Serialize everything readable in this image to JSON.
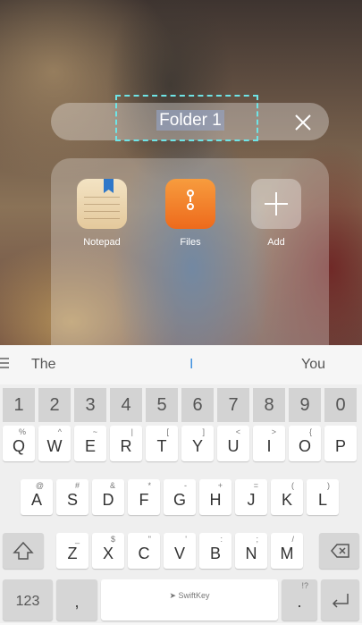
{
  "folder": {
    "name": "Folder 1",
    "close_icon": "close-icon",
    "apps": [
      {
        "label": "Notepad",
        "icon": "notepad-icon"
      },
      {
        "label": "Files",
        "icon": "files-icon"
      },
      {
        "label": "Add",
        "icon": "add-icon"
      }
    ]
  },
  "keyboard": {
    "suggestions": {
      "left": "The",
      "center": "I",
      "right": "You"
    },
    "numbers": [
      "1",
      "2",
      "3",
      "4",
      "5",
      "6",
      "7",
      "8",
      "9",
      "0"
    ],
    "row1": {
      "keys": [
        "Q",
        "W",
        "E",
        "R",
        "T",
        "Y",
        "U",
        "I",
        "O",
        "P"
      ],
      "secondary": [
        "%",
        "^",
        "~",
        "|",
        "[",
        "]",
        "<",
        ">",
        "{",
        ""
      ]
    },
    "row2": {
      "keys": [
        "A",
        "S",
        "D",
        "F",
        "G",
        "H",
        "J",
        "K",
        "L"
      ],
      "secondary": [
        "@",
        "#",
        "&",
        "*",
        "-",
        "+",
        "=",
        "(",
        ")"
      ]
    },
    "row3": {
      "keys": [
        "Z",
        "X",
        "C",
        "V",
        "B",
        "N",
        "M"
      ],
      "secondary": [
        "_",
        "$",
        "\"",
        "'",
        ":",
        ";",
        "/"
      ]
    },
    "bottom": {
      "numbers_label": "123",
      "comma": ",",
      "space_brand": "SwiftKey",
      "period": ".",
      "period_secondary": "!?"
    }
  },
  "colors": {
    "focus_outline": "#6fe4e6",
    "cursor": "#3d8fe0"
  }
}
